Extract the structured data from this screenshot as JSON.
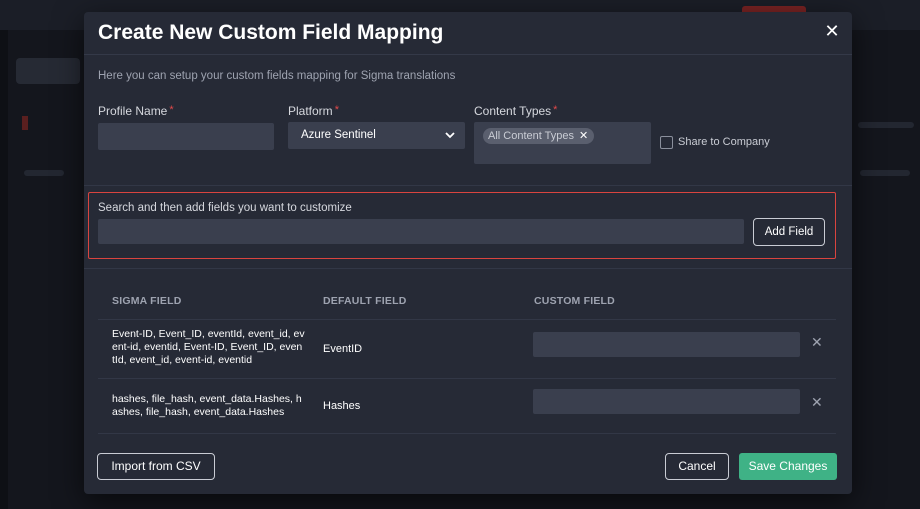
{
  "modal": {
    "title": "Create New Custom Field Mapping",
    "subtitle": "Here you can setup your custom fields mapping for Sigma translations"
  },
  "form": {
    "profile_name": {
      "label": "Profile Name",
      "value": ""
    },
    "platform": {
      "label": "Platform",
      "value": "Azure Sentinel"
    },
    "content_types": {
      "label": "Content Types",
      "chips": [
        "All Content Types"
      ]
    },
    "share": {
      "label": "Share to Company",
      "checked": false
    },
    "required_marker": "*"
  },
  "search": {
    "label": "Search and then add fields you want to customize",
    "value": "",
    "add_button": "Add Field"
  },
  "table": {
    "headers": [
      "SIGMA FIELD",
      "DEFAULT FIELD",
      "CUSTOM FIELD"
    ],
    "rows": [
      {
        "sigma_lines": [
          "Event-ID, Event_ID, eventId, event_id, ev",
          "ent-id, eventid, Event-ID, Event_ID, even",
          "tId, event_id, event-id, eventid"
        ],
        "default": "EventID",
        "custom": ""
      },
      {
        "sigma_lines": [
          "hashes, file_hash, event_data.Hashes, h",
          "ashes, file_hash, event_data.Hashes"
        ],
        "default": "Hashes",
        "custom": ""
      }
    ]
  },
  "footer": {
    "import_button": "Import from CSV",
    "cancel_button": "Cancel",
    "save_button": "Save Changes"
  }
}
